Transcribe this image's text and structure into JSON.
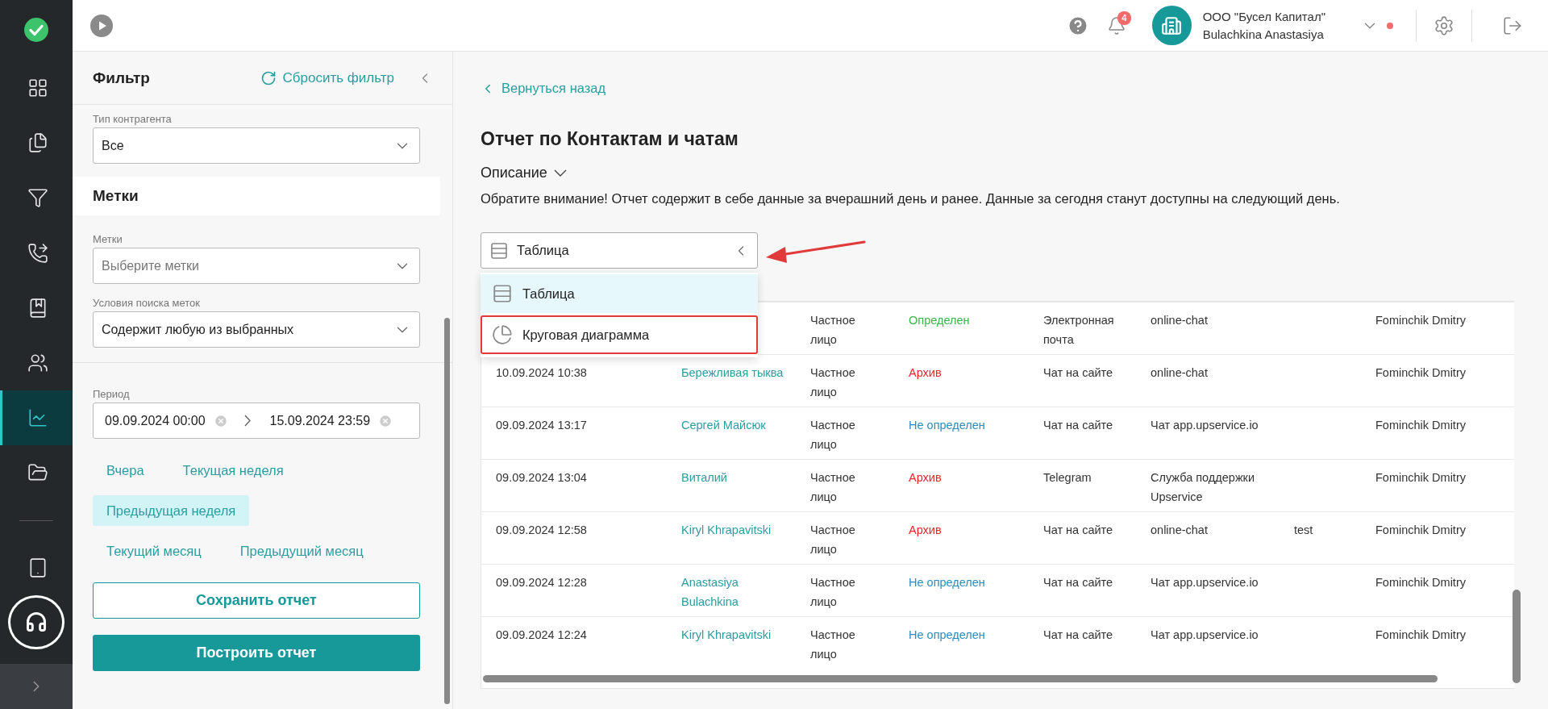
{
  "nav": {
    "main": [
      {
        "selected": false
      },
      {
        "selected": false
      },
      {
        "selected": false
      },
      {
        "selected": false
      },
      {
        "selected": false
      },
      {
        "selected": false
      },
      {
        "selected": true
      },
      {
        "selected": false
      }
    ],
    "extra": [
      {
        "selected": false
      }
    ]
  },
  "topbar": {
    "notifications": "4",
    "company": "ООО \"Бусел Капитал\"",
    "user": "Bulachkina Anastasiya"
  },
  "filter": {
    "title": "Фильтр",
    "reset": "Сбросить фильтр",
    "counterparty": {
      "label": "Тип контрагента",
      "value": "Все"
    },
    "tags_section": "Метки",
    "tags": {
      "label": "Метки",
      "placeholder": "Выберите метки"
    },
    "tag_condition": {
      "label": "Условия поиска меток",
      "value": "Содержит любую из выбранных"
    },
    "period": {
      "label": "Период",
      "from": "09.09.2024 00:00",
      "to": "15.09.2024 23:59"
    },
    "presets": [
      [
        {
          "label": "Вчера",
          "selected": false
        },
        {
          "label": "Текущая неделя",
          "selected": false
        }
      ],
      [
        {
          "label": "Предыдущая неделя",
          "selected": true
        }
      ],
      [
        {
          "label": "Текущий месяц",
          "selected": false
        },
        {
          "label": "Предыдущий месяц",
          "selected": false
        }
      ]
    ],
    "save": "Сохранить отчет",
    "build": "Построить отчет"
  },
  "main": {
    "back": "Вернуться назад",
    "title": "Отчет по Контактам и чатам",
    "description": "Описание",
    "notice": "Обратите внимание! Отчет содержит в себе данные за вчерашний день и ранее. Данные за сегодня станут доступны на следующий день.",
    "view": {
      "value": "Таблица",
      "expanded": true,
      "options": [
        {
          "label": "Таблица",
          "kind": "table",
          "selected": true,
          "outlined": false
        },
        {
          "label": "Круговая диаграмма",
          "kind": "pie",
          "selected": false,
          "outlined": true
        }
      ]
    },
    "rows": [
      {
        "type": "Частное лицо",
        "status": {
          "text": "Определен",
          "color": "#3cb54a"
        },
        "channel": "Электронная почта",
        "source": "online-chat",
        "operator": "Fominchik Dmitry"
      },
      {
        "date": "10.09.2024 10:38",
        "name": "Бережливая тыква",
        "type": "Частное лицо",
        "status": {
          "text": "Архив",
          "color": "#f5222d"
        },
        "channel": "Чат на сайте",
        "source": "online-chat",
        "operator": "Fominchik Dmitry"
      },
      {
        "date": "09.09.2024 13:17",
        "name": "Сергей Майсюк",
        "type": "Частное лицо",
        "status": {
          "text": "Не определен",
          "color": "#2a8dc0"
        },
        "channel": "Чат на сайте",
        "source": "Чат app.upservice.io",
        "operator": "Fominchik Dmitry"
      },
      {
        "date": "09.09.2024 13:04",
        "name": "Виталий",
        "type": "Частное лицо",
        "status": {
          "text": "Архив",
          "color": "#f5222d"
        },
        "channel": "Telegram",
        "source": "Служба поддержки Upservice",
        "operator": "Fominchik Dmitry"
      },
      {
        "date": "09.09.2024 12:58",
        "name": "Kiryl Khrapavitski",
        "type": "Частное лицо",
        "status": {
          "text": "Архив",
          "color": "#f5222d"
        },
        "channel": "Чат на сайте",
        "source": "online-chat",
        "column_7": "test",
        "operator": "Fominchik Dmitry"
      },
      {
        "date": "09.09.2024 12:28",
        "name": "Anastasiya Bulachkina",
        "type": "Частное лицо",
        "status": {
          "text": "Не определен",
          "color": "#2a8dc0"
        },
        "channel": "Чат на сайте",
        "source": "Чат app.upservice.io",
        "operator": "Fominchik Dmitry"
      },
      {
        "date": "09.09.2024 12:24",
        "name": "Kiryl Khrapavitski",
        "type": "Частное лицо",
        "status": {
          "text": "Не определен",
          "color": "#2a8dc0"
        },
        "channel": "Чат на сайте",
        "source": "Чат app.upservice.io",
        "operator": "Fominchik Dmitry"
      }
    ]
  }
}
